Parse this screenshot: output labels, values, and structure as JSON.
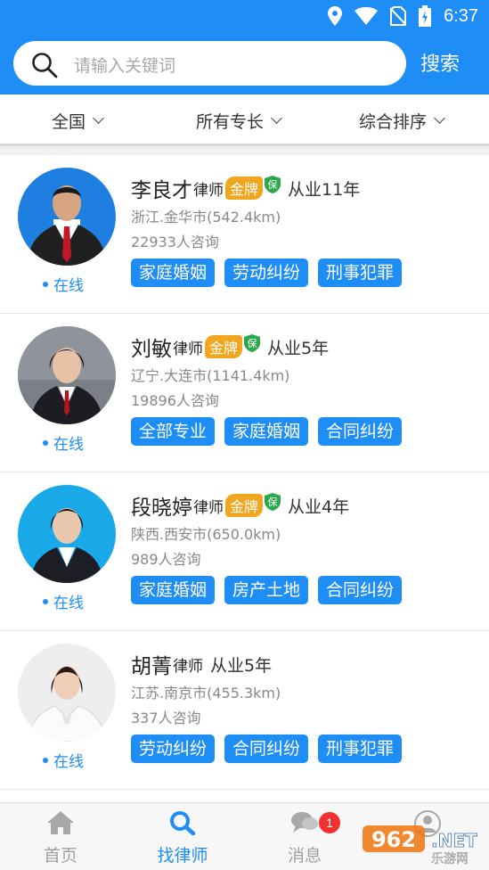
{
  "status_bar": {
    "time": "6:37"
  },
  "search": {
    "placeholder": "请输入关键词",
    "button_label": "搜索"
  },
  "filters": [
    {
      "label": "全国"
    },
    {
      "label": "所有专长"
    },
    {
      "label": "综合排序"
    }
  ],
  "lawyers": [
    {
      "name": "李良才",
      "role": "律师",
      "badge": "金牌",
      "insured_mark": "保",
      "experience": "从业11年",
      "location": "浙江.金华市(542.4km)",
      "consultations": "22933人咨询",
      "status": "在线",
      "tags": [
        "家庭婚姻",
        "劳动纠纷",
        "刑事犯罪"
      ]
    },
    {
      "name": "刘敏",
      "role": "律师",
      "badge": "金牌",
      "insured_mark": "保",
      "experience": "从业5年",
      "location": "辽宁.大连市(1141.4km)",
      "consultations": "19896人咨询",
      "status": "在线",
      "tags": [
        "全部专业",
        "家庭婚姻",
        "合同纠纷"
      ]
    },
    {
      "name": "段晓婷",
      "role": "律师",
      "badge": "金牌",
      "insured_mark": "保",
      "experience": "从业4年",
      "location": "陕西.西安市(650.0km)",
      "consultations": "989人咨询",
      "status": "在线",
      "tags": [
        "家庭婚姻",
        "房产土地",
        "合同纠纷"
      ]
    },
    {
      "name": "胡菁",
      "role": "律师",
      "experience": "从业5年",
      "location": "江苏.南京市(455.3km)",
      "consultations": "337人咨询",
      "status": "在线",
      "tags": [
        "劳动纠纷",
        "合同纠纷",
        "刑事犯罪"
      ]
    }
  ],
  "tabbar": {
    "tabs": [
      {
        "label": "首页",
        "icon": "home-icon"
      },
      {
        "label": "找律师",
        "icon": "search-icon"
      },
      {
        "label": "消息",
        "icon": "chat-icon",
        "badge": "1"
      },
      {
        "label": "",
        "icon": "user-icon"
      }
    ],
    "watermark": "962 NET 乐游网"
  },
  "colors": {
    "primary": "#1e8df5",
    "gold": "#f2a51f",
    "shield": "#2aa84a",
    "badge": "#f23030"
  }
}
